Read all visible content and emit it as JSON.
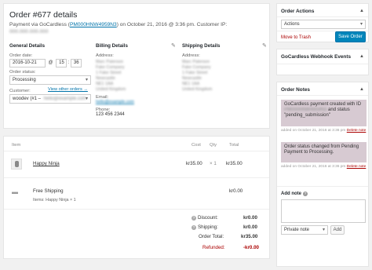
{
  "order": {
    "title": "Order #677 details",
    "payment_prefix": "Payment via GoCardless (",
    "payment_id": "PM000HNW4959N3",
    "payment_suffix": ") on October 21, 2016 @ 3:36 pm. Customer IP:",
    "customer_ip": "000.000.000.000",
    "general": {
      "heading": "General Details",
      "date_label": "Order date:",
      "date_value": "2016-10-21",
      "at": "@",
      "hour": "15",
      "minute": "36",
      "status_label": "Order status:",
      "status_value": "Processing",
      "customer_label": "Customer:",
      "view_other": "View other orders →",
      "customer_value": "woodev (#1 –"
    },
    "billing": {
      "heading": "Billing Details",
      "address_label": "Address:",
      "address_lines": [
        "Marc Paterson",
        "Fake Company",
        "1 Fake Street",
        "Newcastle",
        "NE1 1AA",
        "United Kingdom"
      ],
      "email_label": "Email:",
      "email_value": "hello@example.com",
      "phone_label": "Phone:",
      "phone_value": "123 456 2344"
    },
    "shipping": {
      "heading": "Shipping Details",
      "address_label": "Address:",
      "address_lines": [
        "Marc Paterson",
        "Fake Company",
        "1 Fake Street",
        "Newcastle",
        "NE1 1AA",
        "United Kingdom"
      ]
    }
  },
  "items": {
    "headers": {
      "item": "Item",
      "cost": "Cost",
      "qty": "Qty",
      "total": "Total"
    },
    "line": {
      "name": "Happy Ninja",
      "cost": "kr35.00",
      "qty": "× 1",
      "total": "kr35.00"
    },
    "shipping": {
      "name": "Free Shipping",
      "items_text": "Items: Happy Ninja × 1",
      "total": "kr0.00"
    },
    "totals": {
      "discount_label": "Discount:",
      "discount_value": "kr0.00",
      "shipping_label": "Shipping:",
      "shipping_value": "kr0.00",
      "order_total_label": "Order Total:",
      "order_total_value": "kr35.00",
      "refunded_label": "Refunded:",
      "refunded_value": "-kr0.00"
    }
  },
  "actions": {
    "title": "Order Actions",
    "select_value": "Actions",
    "trash": "Move to Trash",
    "save": "Save Order"
  },
  "webhook": {
    "title": "GoCardless Webhook Events"
  },
  "notes": {
    "title": "Order Notes",
    "note1": {
      "text_a": "GoCardless payment created with ID",
      "text_b": "and status \"pending_submission\"",
      "meta": "added on October 21, 2016 at 3:36 pm",
      "delete": "Delete note"
    },
    "note2": {
      "text": "Order status changed from Pending Payment to Processing.",
      "meta": "added on October 21, 2016 at 3:36 pm",
      "delete": "Delete note"
    },
    "add_label": "Add note",
    "type_value": "Private note",
    "add_button": "Add"
  },
  "colors": {
    "primary": "#0085ba",
    "link": "#0073aa",
    "danger": "#a00",
    "note_bg": "#d7cad2"
  }
}
